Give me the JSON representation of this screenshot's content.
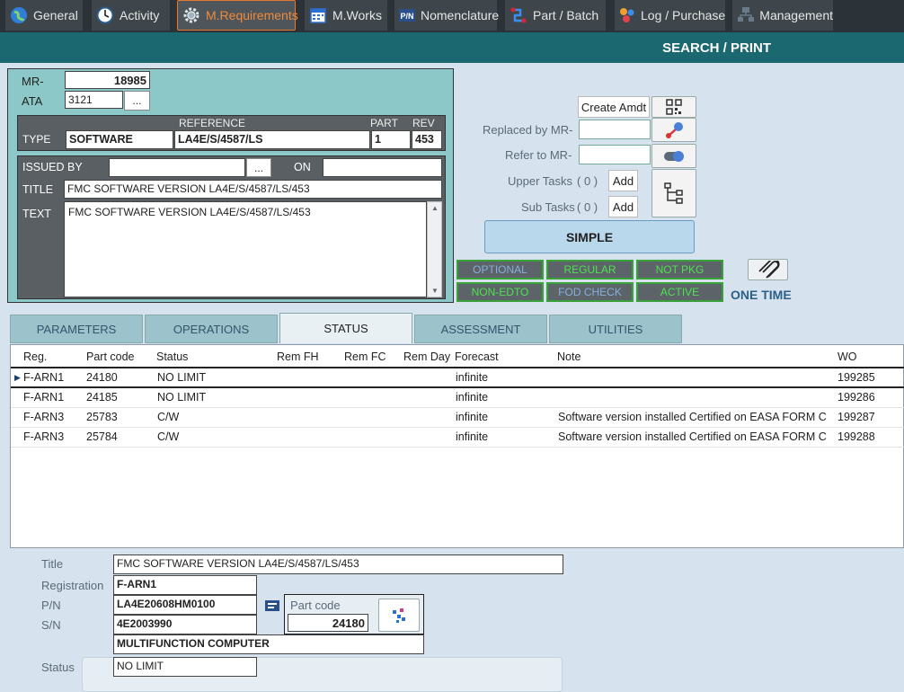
{
  "nav": {
    "tabs": [
      {
        "label": "General",
        "icon": "globe-icon"
      },
      {
        "label": "Activity",
        "icon": "clock-icon"
      },
      {
        "label": "M.Requirements",
        "icon": "gear-icon"
      },
      {
        "label": "M.Works",
        "icon": "calendar-icon"
      },
      {
        "label": "Nomenclature",
        "icon": "pn-icon"
      },
      {
        "label": "Part / Batch",
        "icon": "route-icon"
      },
      {
        "label": "Log / Purchase",
        "icon": "log-icon"
      },
      {
        "label": "Management",
        "icon": "management-icon"
      }
    ],
    "active": "M.Requirements"
  },
  "header": {
    "title": "SEARCH / PRINT"
  },
  "mr": {
    "mr_label": "MR-",
    "mr_value": "18985",
    "ata_label": "ATA",
    "ata_value": "3121",
    "ata_btn": "...",
    "type_label": "TYPE",
    "ref_header": "REFERENCE",
    "part_header": "PART",
    "rev_header": "REV",
    "type_value": "SOFTWARE",
    "ref_value": "LA4E/S/4587/LS",
    "part_value": "1",
    "rev_value": "453",
    "issued_label": "ISSUED BY",
    "issued_value": "",
    "issued_btn": "...",
    "on_label": "ON",
    "on_value": "",
    "title_label": "TITLE",
    "title_value": "FMC SOFTWARE VERSION LA4E/S/4587/LS/453",
    "text_label": "TEXT",
    "text_value": "FMC SOFTWARE VERSION LA4E/S/4587/LS/453"
  },
  "links": {
    "create_amdt": "Create Amdt",
    "replaced_label": "Replaced by MR-",
    "replaced_value": "",
    "refer_label": "Refer to MR-",
    "refer_value": "",
    "upper_label": "Upper Tasks",
    "upper_count": "( 0 )",
    "upper_add": "Add",
    "sub_label": "Sub Tasks",
    "sub_count": "( 0 )",
    "sub_add": "Add",
    "simple": "SIMPLE"
  },
  "flags": [
    {
      "label": "OPTIONAL",
      "color": "#86aedb"
    },
    {
      "label": "REGULAR",
      "color": "#4de24d"
    },
    {
      "label": "NOT PKG",
      "color": "#4de24d"
    },
    {
      "label": "NON-EDTO",
      "color": "#4de24d"
    },
    {
      "label": "FOD CHECK",
      "color": "#86aedb"
    },
    {
      "label": "ACTIVE",
      "color": "#4de24d"
    }
  ],
  "one_time": "ONE TIME",
  "sections": {
    "tabs": [
      "PARAMETERS",
      "OPERATIONS",
      "STATUS",
      "ASSESSMENT",
      "UTILITIES"
    ],
    "active": "STATUS"
  },
  "grid": {
    "columns": [
      "Reg.",
      "Part code",
      "Status",
      "Rem FH",
      "Rem FC",
      "Rem Day",
      "Forecast",
      "Note",
      "WO"
    ],
    "rows": [
      [
        "F-ARN1",
        "24180",
        "NO LIMIT",
        "",
        "",
        "",
        "infinite",
        "",
        "199285"
      ],
      [
        "F-ARN1",
        "24185",
        "NO LIMIT",
        "",
        "",
        "",
        "infinite",
        "",
        "199286"
      ],
      [
        "F-ARN3",
        "25783",
        "C/W",
        "",
        "",
        "",
        "infinite",
        "Software version installed Certified on EASA FORM C",
        "199287"
      ],
      [
        "F-ARN3",
        "25784",
        "C/W",
        "",
        "",
        "",
        "infinite",
        "Software version installed Certified on EASA FORM C",
        "199288"
      ]
    ],
    "selected_row": 0
  },
  "detail": {
    "title_label": "Title",
    "title_value": "FMC SOFTWARE VERSION LA4E/S/4587/LS/453",
    "reg_label": "Registration",
    "reg_value": "F-ARN1",
    "pn_label": "P/N",
    "pn_value": "LA4E20608HM0100",
    "sn_label": "S/N",
    "sn_value": "4E2003990",
    "desc_value": "MULTIFUNCTION COMPUTER",
    "partcode_label": "Part code",
    "partcode_value": "24180",
    "status_label": "Status",
    "status_value": "NO LIMIT"
  },
  "colors": {
    "accent": "#f08a3a",
    "teal_bar": "#1c6870",
    "panel": "#8cc8c8",
    "active_flag": "#4de24d",
    "blue_flag": "#86aedb"
  }
}
